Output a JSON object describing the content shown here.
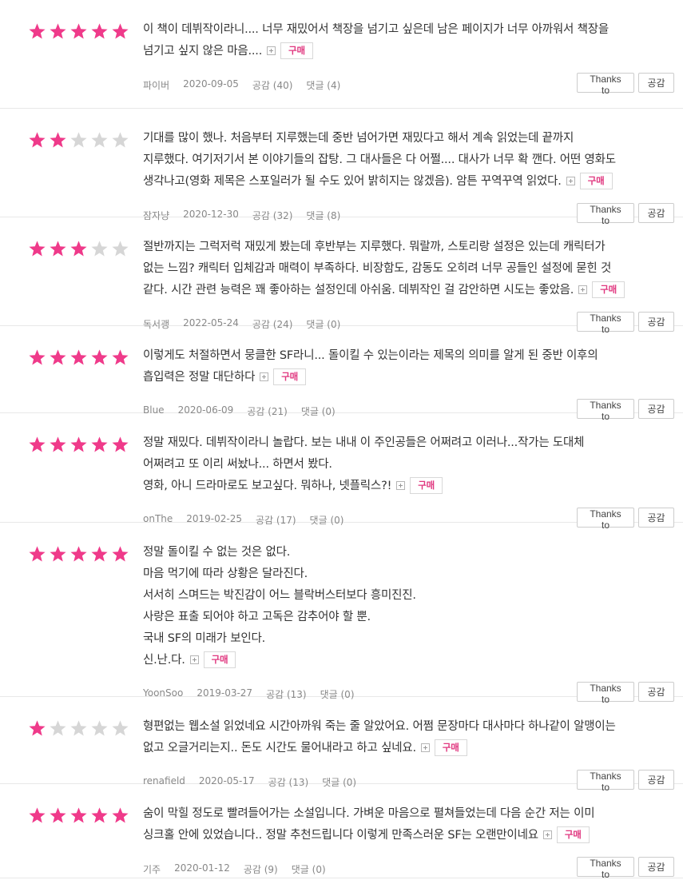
{
  "colors": {
    "star_on": "#ef3a8a",
    "star_off": "#d6d6d6",
    "buy": "#e0377f"
  },
  "icons": {
    "star": "star-icon",
    "more": "expand-plus-icon"
  },
  "buttons": {
    "thanks": "Thanks to",
    "like": "공감"
  },
  "reviews": [
    {
      "rating": 5,
      "lines": [
        "이 책이 데뷔작이라니.... 너무 재밌어서 책장을 넘기고 싶은데 남은 페이지가 너무 아까워서 책장을",
        "넘기고 싶지 않은 마음...."
      ],
      "badge": "구매",
      "user": "파이버",
      "date": "2020-09-05",
      "likes": "공감 (40)",
      "comments": "댓글 (4)"
    },
    {
      "rating": 2,
      "lines": [
        "기대를 많이 했나. 처음부터 지루했는데 중반 넘어가면 재밌다고 해서 계속 읽었는데 끝까지",
        "지루했다. 여기저기서 본 이야기들의 잡탕. 그 대사들은 다 어쩔.... 대사가 너무 확 깬다. 어떤 영화도",
        "생각나고(영화 제목은 스포일러가 될 수도 있어 밝히지는 않겠음). 암튼 꾸역꾸역 읽었다."
      ],
      "badge": "구매",
      "user": "잠자냥",
      "date": "2020-12-30",
      "likes": "공감 (32)",
      "comments": "댓글 (8)"
    },
    {
      "rating": 3,
      "lines": [
        "절반까지는 그럭저럭 재밌게 봤는데 후반부는 지루했다. 뭐랄까, 스토리랑 설정은 있는데 캐릭터가",
        "없는 느낌? 캐릭터 입체감과 매력이 부족하다. 비장함도, 감동도 오히려 너무 공들인 설정에 묻힌 것",
        "같다. 시간 관련 능력은 꽤 좋아하는 설정인데 아쉬움. 데뷔작인 걸 감안하면 시도는 좋았음."
      ],
      "badge": "구매",
      "user": "독서괭",
      "date": "2022-05-24",
      "likes": "공감 (24)",
      "comments": "댓글 (0)"
    },
    {
      "rating": 5,
      "lines": [
        "이렇게도 처절하면서 뭉클한 SF라니... 돌이킬 수 있는이라는 제목의 의미를 알게 된 중반 이후의",
        "흡입력은 정말 대단하다"
      ],
      "badge": "구매",
      "user": "Blue",
      "date": "2020-06-09",
      "likes": "공감 (21)",
      "comments": "댓글 (0)"
    },
    {
      "rating": 5,
      "lines": [
        "정말 재밌다. 데뷔작이라니 놀랍다. 보는 내내 이 주인공들은 어쩌려고 이러나...작가는 도대체",
        "어쩌려고 또 이리 써놨나... 하면서 봤다.",
        "영화, 아니 드라마로도 보고싶다. 뭐하나, 넷플릭스?!"
      ],
      "badge": "구매",
      "user": "onThe",
      "date": "2019-02-25",
      "likes": "공감 (17)",
      "comments": "댓글 (0)"
    },
    {
      "rating": 5,
      "lines": [
        "정말 돌이킬 수 없는 것은 없다.",
        "마음 먹기에 따라 상황은 달라진다.",
        "서서히 스며드는 박진감이 어느 블락버스터보다 흥미진진.",
        "사랑은 표출 되어야 하고 고독은 감추어야 할 뿐.",
        "국내 SF의 미래가 보인다.",
        "신.난.다."
      ],
      "badge": "구매",
      "user": "YoonSoo",
      "date": "2019-03-27",
      "likes": "공감 (13)",
      "comments": "댓글 (0)"
    },
    {
      "rating": 1,
      "lines": [
        "형편없는 웹소설 읽었네요 시간아까워 죽는 줄 알았어요. 어쩜 문장마다 대사마다 하나같이 알맹이는",
        "없고 오글거리는지.. 돈도 시간도 물어내라고 하고 싶네요."
      ],
      "badge": "구매",
      "user": "renafield",
      "date": "2020-05-17",
      "likes": "공감 (13)",
      "comments": "댓글 (0)"
    },
    {
      "rating": 5,
      "lines": [
        "숨이 막힐 정도로 빨려들어가는 소설입니다. 가벼운 마음으로 펼쳐들었는데 다음 순간 저는 이미",
        "싱크홀 안에 있었습니다.. 정말 추천드립니다 이렇게 만족스러운 SF는 오랜만이네요"
      ],
      "badge": "구매",
      "user": "기주",
      "date": "2020-01-12",
      "likes": "공감 (9)",
      "comments": "댓글 (0)"
    }
  ]
}
